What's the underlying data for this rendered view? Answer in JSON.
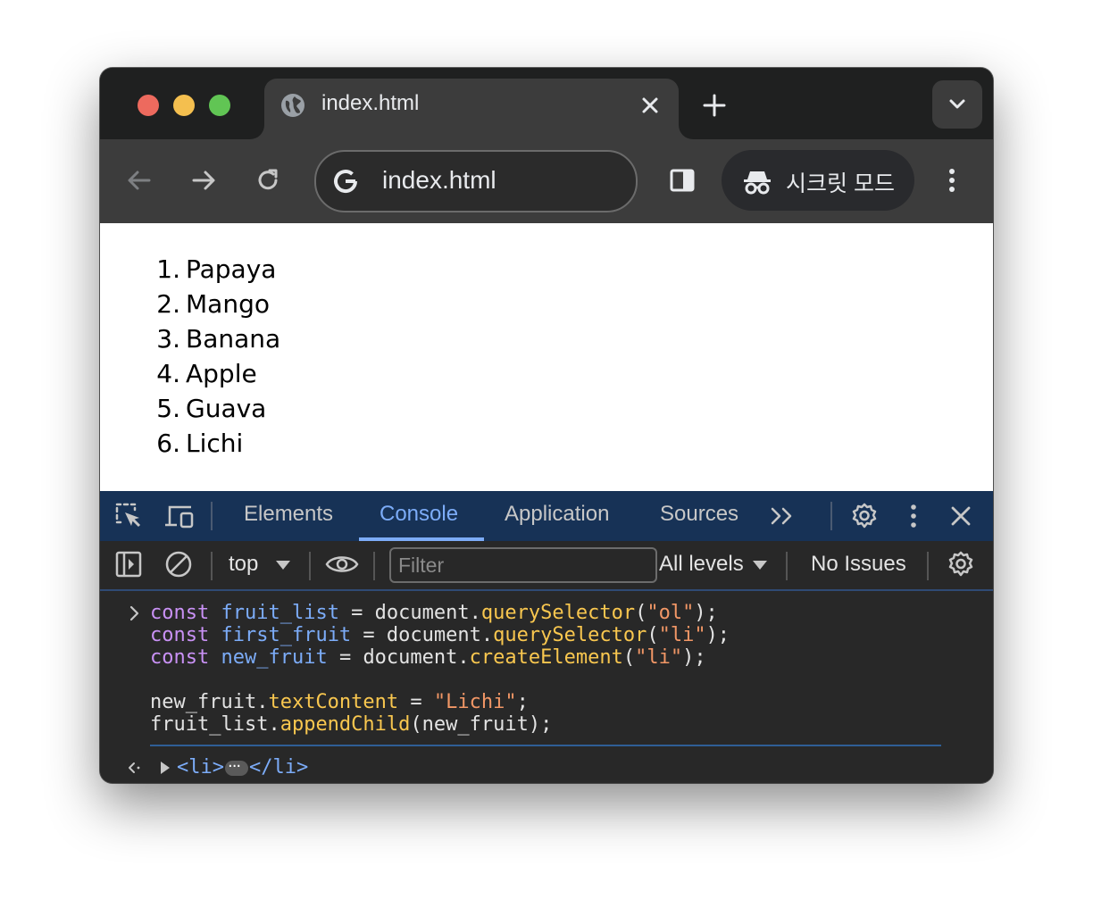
{
  "tab": {
    "title": "index.html"
  },
  "omnibox": {
    "url": "index.html"
  },
  "incognito": {
    "label": "시크릿 모드"
  },
  "page": {
    "list": [
      {
        "number": "1.",
        "text": "Papaya"
      },
      {
        "number": "2.",
        "text": "Mango"
      },
      {
        "number": "3.",
        "text": "Banana"
      },
      {
        "number": "4.",
        "text": "Apple"
      },
      {
        "number": "5.",
        "text": "Guava"
      },
      {
        "number": "6.",
        "text": "Lichi"
      }
    ]
  },
  "devtools": {
    "tabs": [
      "Elements",
      "Console",
      "Application",
      "Sources"
    ],
    "active_tab": "Console",
    "context": "top",
    "filter_placeholder": "Filter",
    "levels": "All levels",
    "issues": "No Issues",
    "code": {
      "l1": {
        "kw": "const",
        "var": "fruit_list",
        "mid": " = document.",
        "fn": "querySelector",
        "open": "(",
        "str": "\"ol\"",
        "close": ");"
      },
      "l2": {
        "kw": "const",
        "var": "first_fruit",
        "mid": " = document.",
        "fn": "querySelector",
        "open": "(",
        "str": "\"li\"",
        "close": ");"
      },
      "l3": {
        "kw": "const",
        "var": "new_fruit",
        "mid": " = document.",
        "fn": "createElement",
        "open": "(",
        "str": "\"li\"",
        "close": ");"
      },
      "l4": {
        "obj": "new_fruit.",
        "fn": "textContent",
        "mid": " = ",
        "str": "\"Lichi\"",
        "close": ";"
      },
      "l5": {
        "obj": "fruit_list.",
        "fn": "appendChild",
        "rest": "(new_fruit);"
      }
    },
    "result": {
      "open": "<li>",
      "close": "</li>"
    }
  }
}
